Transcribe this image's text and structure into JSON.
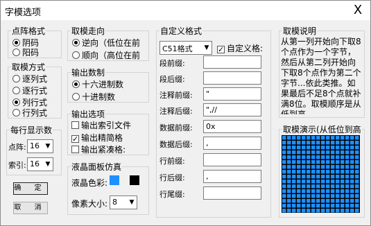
{
  "window": {
    "title": "字模选项",
    "close_symbol": "X"
  },
  "dot_format": {
    "label": "点阵格式",
    "options": [
      "阴码",
      "阳码"
    ],
    "selected": 0
  },
  "mold_method": {
    "label": "取模方式",
    "options": [
      "逐列式",
      "逐行式",
      "列行式",
      "行列式"
    ],
    "selected": 2
  },
  "per_line": {
    "label": "每行显示数",
    "dot_label": "点阵:",
    "dot_value": "16",
    "index_label": "索引:",
    "index_value": "16"
  },
  "buttons": {
    "ok": "确 定",
    "cancel": "取 消"
  },
  "direction": {
    "label": "取模走向",
    "options": [
      "逆向（低位在前",
      "顺向（高位在前"
    ],
    "selected": 0
  },
  "output_base": {
    "label": "输出数制",
    "options": [
      "十六进制数",
      "十进制数"
    ],
    "selected": 0
  },
  "output_options": {
    "label": "输出选项",
    "items": [
      {
        "label": "输出索引文件",
        "checked": false
      },
      {
        "label": "输出精简格",
        "checked": true
      },
      {
        "label": "输出紧凑格:",
        "checked": false
      }
    ]
  },
  "lcd_sim": {
    "label": "液晶面板仿真",
    "color_label": "液晶色彩:",
    "pixel_label": "像素大小:",
    "pixel_value": "8",
    "colors": [
      "#1e90ff",
      "#000000"
    ]
  },
  "custom_format": {
    "label": "自定义格式",
    "format_value": "C51格式",
    "custom_check_label": "自定义格:",
    "custom_checked": true,
    "fields": [
      {
        "label": "段前缀:",
        "value": ""
      },
      {
        "label": "段后缀:",
        "value": ""
      },
      {
        "label": "注释前缀:",
        "value": "\""
      },
      {
        "label": "注释后缀:",
        "value": "\",//"
      },
      {
        "label": "数据前缀:",
        "value": "0x"
      },
      {
        "label": "数据后缀:",
        "value": ","
      },
      {
        "label": "行前缀:",
        "value": ""
      },
      {
        "label": "行后缀:",
        "value": ","
      },
      {
        "label": "行尾缀:",
        "value": ""
      }
    ]
  },
  "mold_desc": {
    "label": "取模说明",
    "text": "从第一列开始向下取8个点作为一个字节，然后从第二列开始向下取8个点作为第二个字节...依此类推。如果最后不足8个点就补满8位。取模顺序是从低到高"
  },
  "mold_demo": {
    "label": "取模演示(从低位到高",
    "dot_color": "#1e90ff"
  }
}
